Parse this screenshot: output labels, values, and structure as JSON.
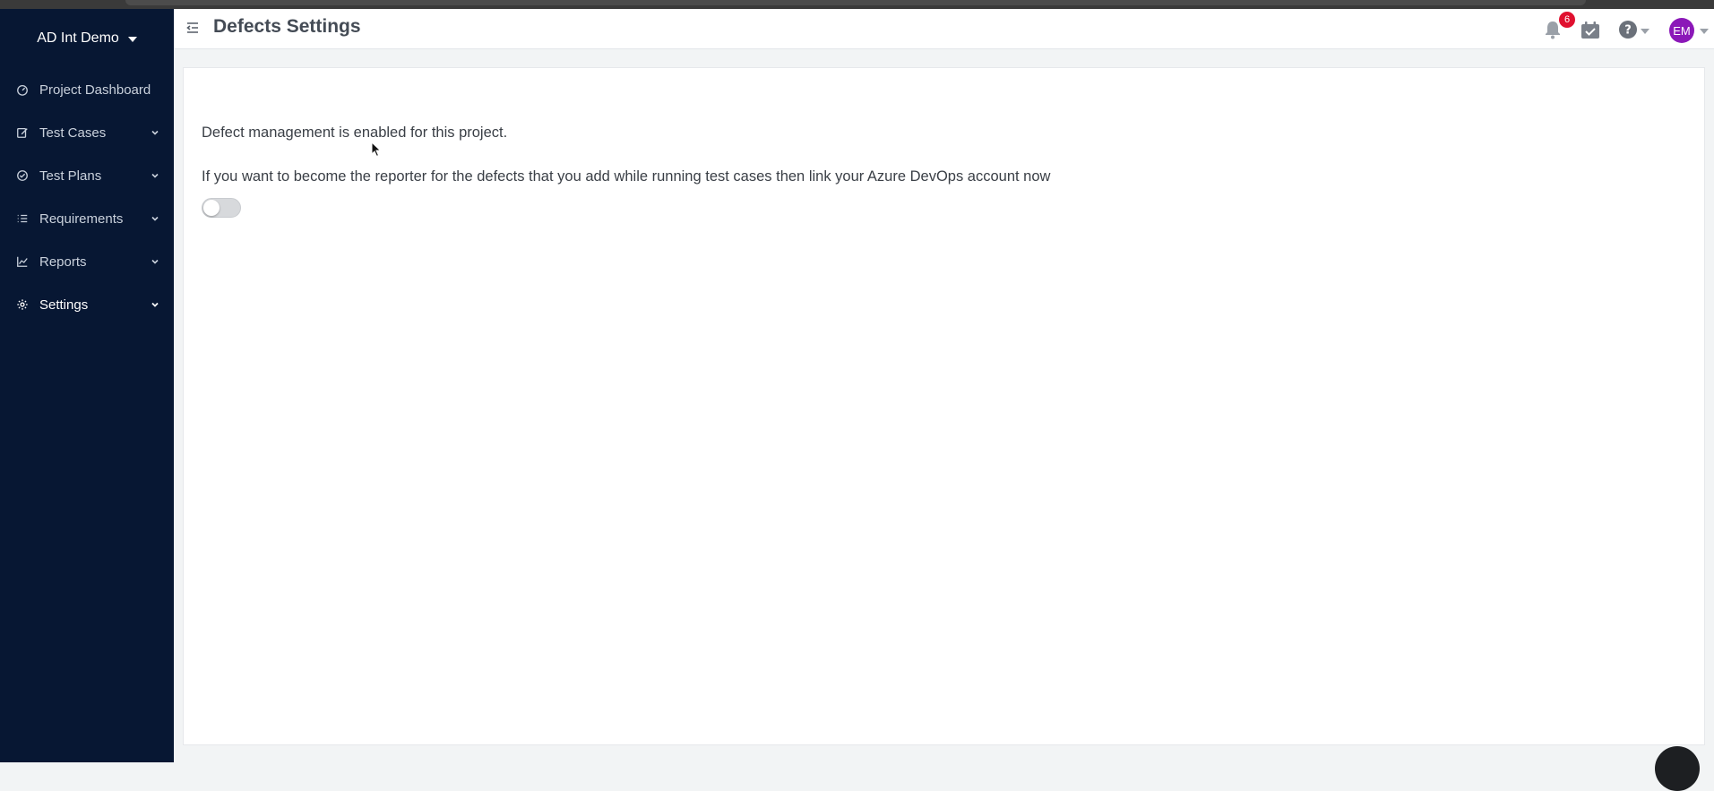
{
  "project": {
    "name": "AD Int Demo"
  },
  "sidebar": {
    "items": [
      {
        "label": "Project Dashboard",
        "icon": "dashboard-icon",
        "expandable": false
      },
      {
        "label": "Test Cases",
        "icon": "edit-icon",
        "expandable": true
      },
      {
        "label": "Test Plans",
        "icon": "check-circle-icon",
        "expandable": true
      },
      {
        "label": "Requirements",
        "icon": "list-icon",
        "expandable": true
      },
      {
        "label": "Reports",
        "icon": "chart-line-icon",
        "expandable": true
      },
      {
        "label": "Settings",
        "icon": "gear-icon",
        "expandable": true,
        "active": true
      }
    ]
  },
  "header": {
    "title": "Defects Settings",
    "notification_count": "6",
    "avatar_initials": "EM"
  },
  "main": {
    "message_enabled": "Defect management is enabled for this project.",
    "message_link": "If you want to become the reporter for the defects that you add while running test cases then link your Azure DevOps account now",
    "link_toggle_on": false
  },
  "colors": {
    "sidebar_bg": "#071733",
    "badge": "#e0102f",
    "avatar": "#8b18b8"
  }
}
